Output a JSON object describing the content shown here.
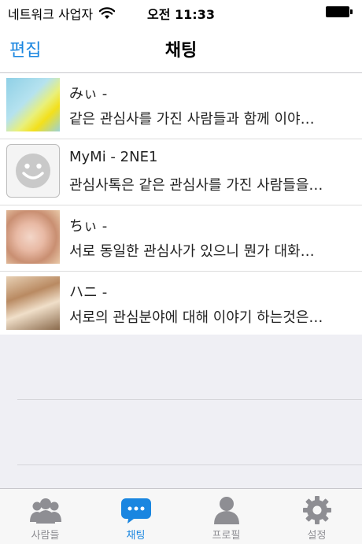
{
  "status_bar": {
    "carrier": "네트워크 사업자",
    "time": "오전 11:33"
  },
  "nav": {
    "edit_label": "편집",
    "title": "채팅"
  },
  "chats": [
    {
      "name": "みぃ -",
      "preview": "같은 관심사를 가진 사람들과 함께 이야…"
    },
    {
      "name": "MyMi - 2NE1",
      "preview": "관심사톡은 같은 관심사를 가진 사람들을…"
    },
    {
      "name": "ちぃ -",
      "preview": "서로 동일한 관심사가 있으니 뭔가 대화…"
    },
    {
      "name": "ハニ -",
      "preview": "서로의 관심분야에 대해 이야기 하는것은…"
    }
  ],
  "tabs": [
    {
      "label": "사람들",
      "icon": "people-icon"
    },
    {
      "label": "채팅",
      "icon": "chat-bubble-icon",
      "active": true
    },
    {
      "label": "프로필",
      "icon": "profile-icon"
    },
    {
      "label": "설정",
      "icon": "gear-icon"
    }
  ],
  "colors": {
    "accent": "#1a86e0",
    "inactive_tab": "#8e8e93",
    "background_empty": "#efeff4"
  }
}
